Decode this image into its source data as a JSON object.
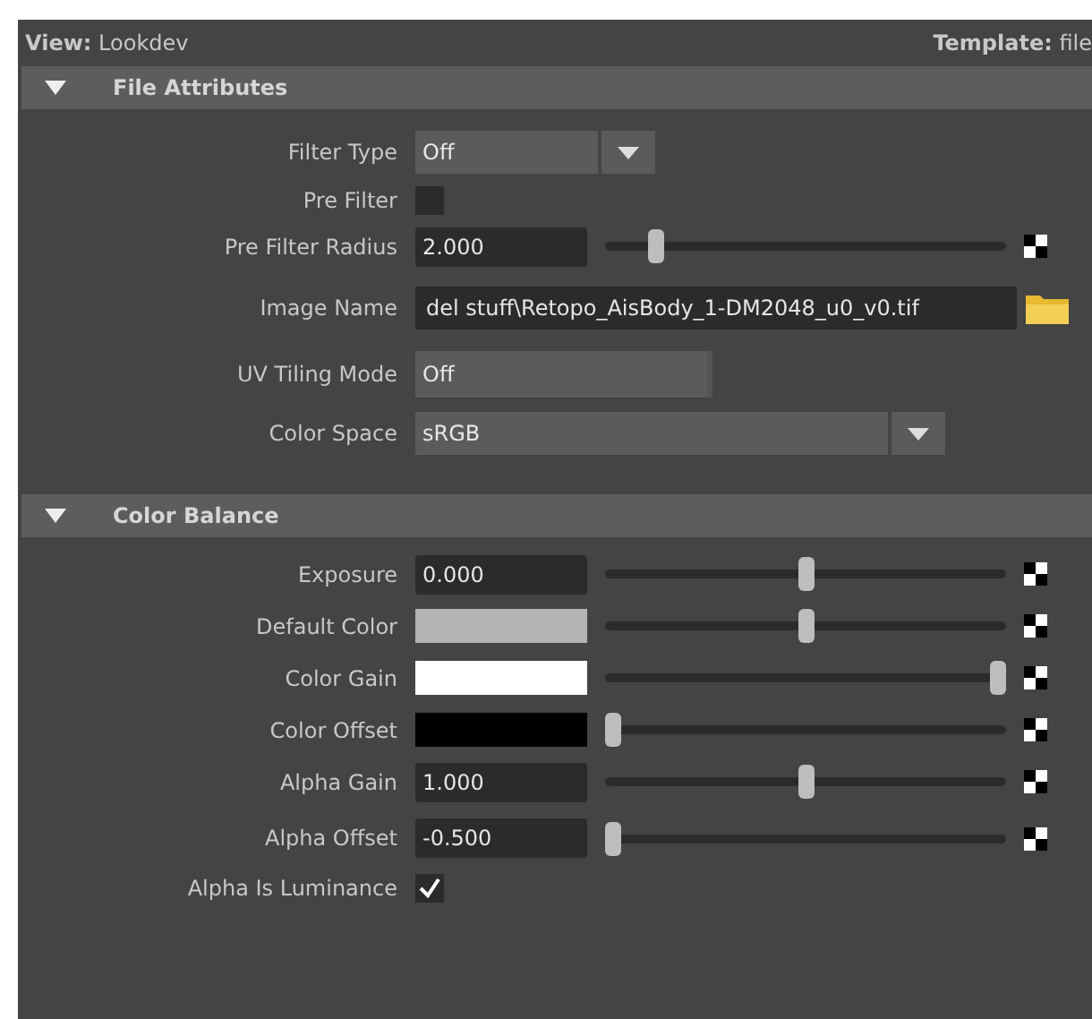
{
  "header": {
    "view_label": "View:",
    "view_value": "Lookdev",
    "template_label": "Template:",
    "template_value": "file"
  },
  "sections": [
    {
      "title": "File Attributes",
      "expanded": true,
      "rows": [
        {
          "kind": "dropdown",
          "label": "Filter Type",
          "value": "Off"
        },
        {
          "kind": "checkbox",
          "label": "Pre Filter",
          "checked": false
        },
        {
          "kind": "slider",
          "label": "Pre Filter Radius",
          "value": "2.000",
          "level": 0.11
        },
        {
          "kind": "file",
          "label": "Image Name",
          "value": "del stuff\\Retopo_AisBody_1-DM2048_u0_v0.tif"
        },
        {
          "kind": "option",
          "label": "UV Tiling Mode",
          "value": "Off"
        },
        {
          "kind": "combo",
          "label": "Color Space",
          "value": "sRGB"
        }
      ]
    },
    {
      "title": "Color Balance",
      "expanded": true,
      "rows": [
        {
          "kind": "slider",
          "label": "Exposure",
          "value": "0.000",
          "level": 0.5
        },
        {
          "kind": "color",
          "label": "Default Color",
          "color": "#b4b4b4",
          "level": 0.5
        },
        {
          "kind": "color",
          "label": "Color Gain",
          "color": "#ffffff",
          "level": 1.0
        },
        {
          "kind": "color",
          "label": "Color Offset",
          "color": "#000000",
          "level": 0.0
        },
        {
          "kind": "slider",
          "label": "Alpha Gain",
          "value": "1.000",
          "level": 0.5
        },
        {
          "kind": "slider",
          "label": "Alpha Offset",
          "value": "-0.500",
          "level": 0.0
        },
        {
          "kind": "checkbox",
          "label": "Alpha Is Luminance",
          "checked": true
        }
      ]
    }
  ]
}
